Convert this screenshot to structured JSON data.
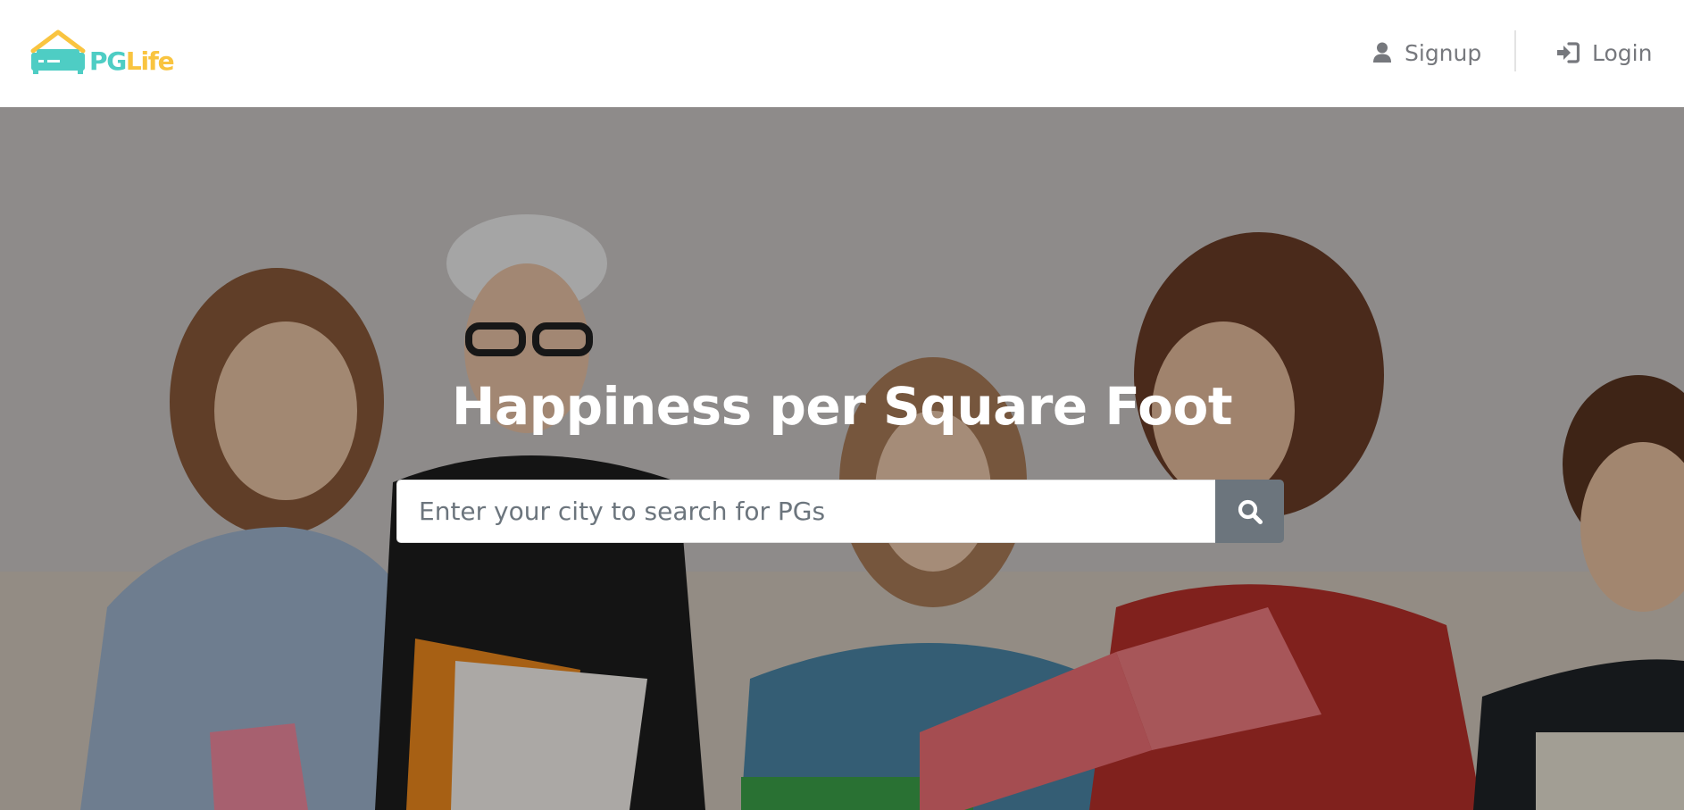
{
  "brand": {
    "name_part1": "PG",
    "name_part2": "Life",
    "primary_color": "#4ecdc4",
    "secondary_color": "#f9c440"
  },
  "nav": {
    "signup": {
      "label": "Signup",
      "icon": "user-icon"
    },
    "login": {
      "label": "Login",
      "icon": "sign-in-icon"
    }
  },
  "hero": {
    "title": "Happiness per Square Foot",
    "search": {
      "placeholder": "Enter your city to search for PGs",
      "value": "",
      "button_icon": "search-icon"
    }
  },
  "colors": {
    "nav_text": "#76787d",
    "search_button": "#6c757d"
  }
}
